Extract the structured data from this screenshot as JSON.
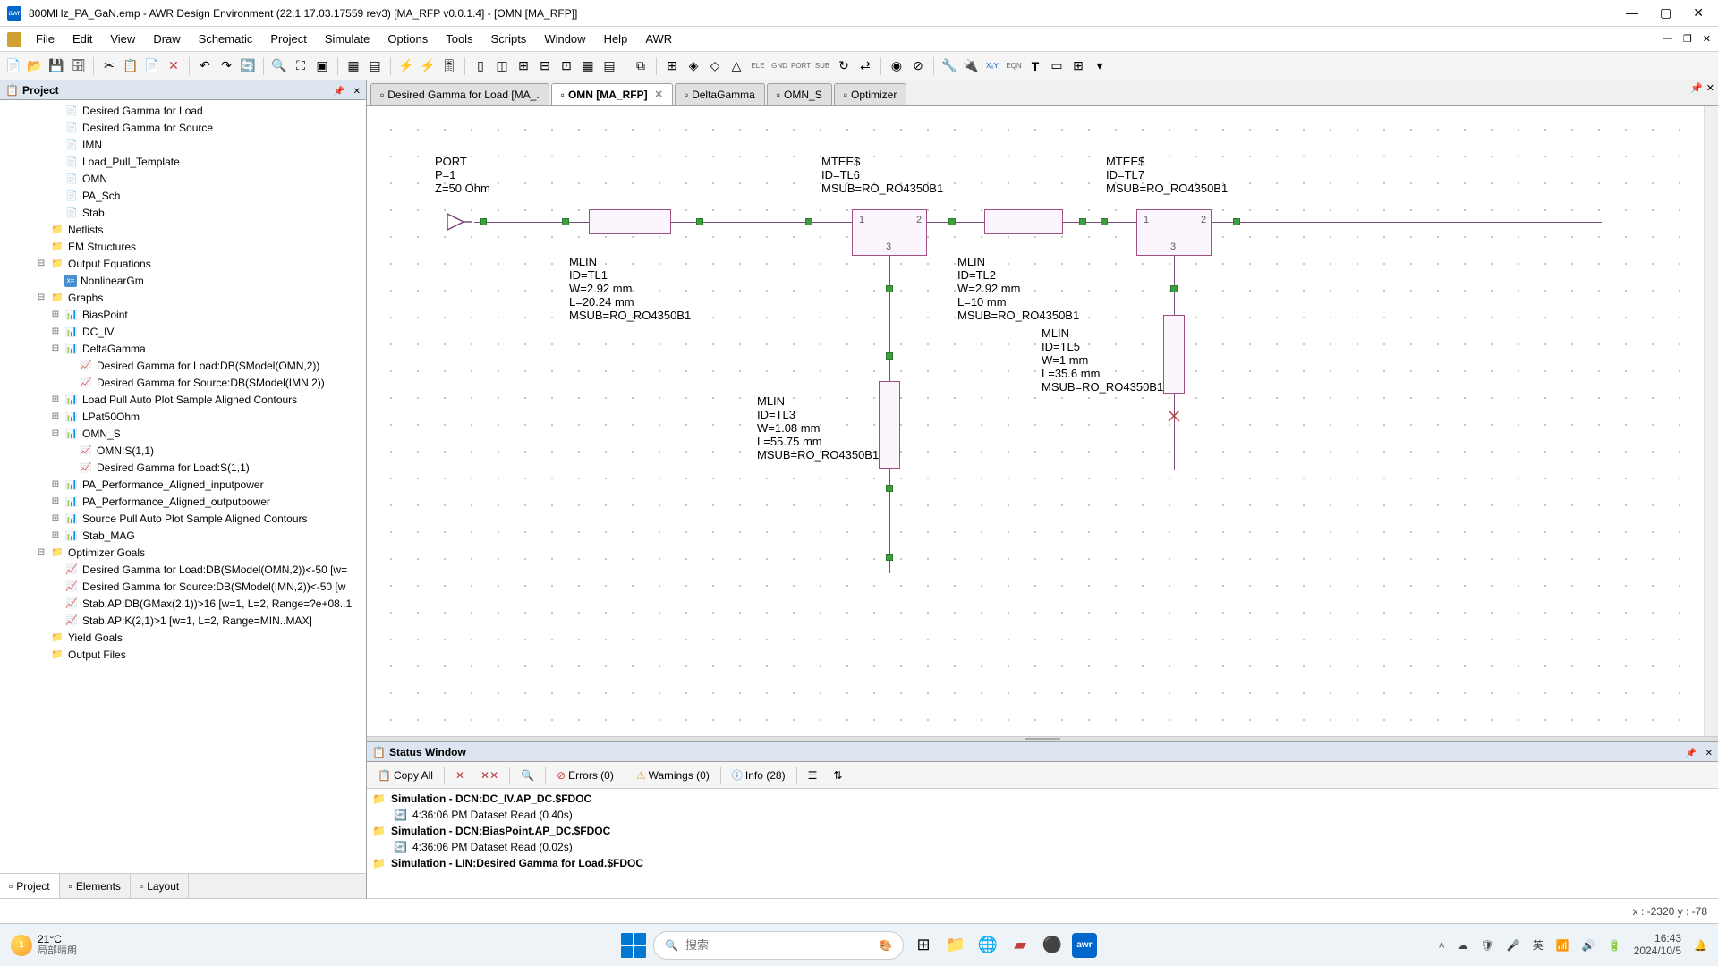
{
  "window": {
    "title": "800MHz_PA_GaN.emp - AWR Design Environment (22.1 17.03.17559 rev3) [MA_RFP v0.0.1.4] - [OMN [MA_RFP]]",
    "app_badge": "awr"
  },
  "menu": [
    "File",
    "Edit",
    "View",
    "Draw",
    "Schematic",
    "Project",
    "Simulate",
    "Options",
    "Tools",
    "Scripts",
    "Window",
    "Help",
    "AWR"
  ],
  "project_panel": {
    "title": "Project",
    "tree": [
      {
        "lvl": 3,
        "exp": "",
        "ic": "sch",
        "label": "Desired Gamma for Load"
      },
      {
        "lvl": 3,
        "exp": "",
        "ic": "sch",
        "label": "Desired Gamma for Source"
      },
      {
        "lvl": 3,
        "exp": "",
        "ic": "sch",
        "label": "IMN"
      },
      {
        "lvl": 3,
        "exp": "",
        "ic": "sch",
        "label": "Load_Pull_Template"
      },
      {
        "lvl": 3,
        "exp": "",
        "ic": "sch",
        "label": "OMN"
      },
      {
        "lvl": 3,
        "exp": "",
        "ic": "sch",
        "label": "PA_Sch"
      },
      {
        "lvl": 3,
        "exp": "",
        "ic": "sch",
        "label": "Stab"
      },
      {
        "lvl": 2,
        "exp": "",
        "ic": "folder",
        "label": "Netlists"
      },
      {
        "lvl": 2,
        "exp": "",
        "ic": "folder",
        "label": "EM Structures"
      },
      {
        "lvl": 2,
        "exp": "-",
        "ic": "folder",
        "label": "Output Equations"
      },
      {
        "lvl": 3,
        "exp": "",
        "ic": "eq",
        "label": "NonlinearGm"
      },
      {
        "lvl": 2,
        "exp": "-",
        "ic": "folder",
        "label": "Graphs"
      },
      {
        "lvl": 3,
        "exp": "+",
        "ic": "graph",
        "label": "BiasPoint"
      },
      {
        "lvl": 3,
        "exp": "+",
        "ic": "graph",
        "label": "DC_IV"
      },
      {
        "lvl": 3,
        "exp": "-",
        "ic": "graph",
        "label": "DeltaGamma"
      },
      {
        "lvl": 4,
        "exp": "",
        "ic": "meas",
        "label": "Desired Gamma for Load:DB(SModel(OMN,2))"
      },
      {
        "lvl": 4,
        "exp": "",
        "ic": "meas",
        "label": "Desired Gamma for Source:DB(SModel(IMN,2))"
      },
      {
        "lvl": 3,
        "exp": "+",
        "ic": "graph",
        "label": "Load Pull Auto Plot Sample Aligned Contours"
      },
      {
        "lvl": 3,
        "exp": "+",
        "ic": "graph",
        "label": "LPat50Ohm"
      },
      {
        "lvl": 3,
        "exp": "-",
        "ic": "graph",
        "label": "OMN_S"
      },
      {
        "lvl": 4,
        "exp": "",
        "ic": "meas",
        "label": "OMN:S(1,1)"
      },
      {
        "lvl": 4,
        "exp": "",
        "ic": "meas",
        "label": "Desired Gamma for Load:S(1,1)"
      },
      {
        "lvl": 3,
        "exp": "+",
        "ic": "graph",
        "label": "PA_Performance_Aligned_inputpower"
      },
      {
        "lvl": 3,
        "exp": "+",
        "ic": "graph",
        "label": "PA_Performance_Aligned_outputpower"
      },
      {
        "lvl": 3,
        "exp": "+",
        "ic": "graph",
        "label": "Source Pull Auto Plot Sample Aligned Contours"
      },
      {
        "lvl": 3,
        "exp": "+",
        "ic": "graph",
        "label": "Stab_MAG"
      },
      {
        "lvl": 2,
        "exp": "-",
        "ic": "folder",
        "label": "Optimizer Goals"
      },
      {
        "lvl": 3,
        "exp": "",
        "ic": "meas",
        "label": "Desired Gamma for Load:DB(SModel(OMN,2))<-50 [w="
      },
      {
        "lvl": 3,
        "exp": "",
        "ic": "meas",
        "label": "Desired Gamma for Source:DB(SModel(IMN,2))<-50 [w"
      },
      {
        "lvl": 3,
        "exp": "",
        "ic": "meas",
        "label": "Stab.AP:DB(GMax(2,1))>16 [w=1, L=2, Range=?e+08..1"
      },
      {
        "lvl": 3,
        "exp": "",
        "ic": "meas",
        "label": "Stab.AP:K(2,1)>1 [w=1, L=2, Range=MIN..MAX]"
      },
      {
        "lvl": 2,
        "exp": "",
        "ic": "folder",
        "label": "Yield Goals"
      },
      {
        "lvl": 2,
        "exp": "",
        "ic": "folder",
        "label": "Output Files"
      }
    ],
    "tabs": [
      {
        "label": "Project",
        "active": true
      },
      {
        "label": "Elements",
        "active": false
      },
      {
        "label": "Layout",
        "active": false
      }
    ]
  },
  "doc_tabs": [
    {
      "label": "Desired Gamma for Load [MA_.",
      "active": false,
      "close": false
    },
    {
      "label": "OMN [MA_RFP]",
      "active": true,
      "close": true
    },
    {
      "label": "DeltaGamma",
      "active": false,
      "close": false
    },
    {
      "label": "OMN_S",
      "active": false,
      "close": false
    },
    {
      "label": "Optimizer",
      "active": false,
      "close": false
    }
  ],
  "schematic": {
    "port": {
      "lines": [
        "PORT",
        "P=1",
        "Z=50 Ohm"
      ]
    },
    "mtee1": {
      "lines": [
        "MTEE$",
        "ID=TL6",
        "MSUB=RO_RO4350B1"
      ]
    },
    "mtee2": {
      "lines": [
        "MTEE$",
        "ID=TL7",
        "MSUB=RO_RO4350B1"
      ]
    },
    "mlin1": {
      "lines": [
        "MLIN",
        "ID=TL1",
        "W=2.92 mm",
        "L=20.24 mm",
        "MSUB=RO_RO4350B1"
      ]
    },
    "mlin2": {
      "lines": [
        "MLIN",
        "ID=TL2",
        "W=2.92 mm",
        "L=10 mm",
        "MSUB=RO_RO4350B1"
      ]
    },
    "mlin3": {
      "lines": [
        "MLIN",
        "ID=TL3",
        "W=1.08 mm",
        "L=55.75 mm",
        "MSUB=RO_RO4350B1"
      ]
    },
    "mlin5": {
      "lines": [
        "MLIN",
        "ID=TL5",
        "W=1 mm",
        "L=35.6 mm",
        "MSUB=RO_RO4350B1"
      ]
    }
  },
  "status_panel": {
    "title": "Status Window",
    "copy_all": "Copy All",
    "errors": "Errors (0)",
    "warnings": "Warnings (0)",
    "info": "Info (28)",
    "log": [
      {
        "type": "hdr",
        "label": "Simulation   - DCN:DC_IV.AP_DC.$FDOC"
      },
      {
        "type": "sub",
        "label": "4:36:06 PM    Dataset Read (0.40s)"
      },
      {
        "type": "hdr",
        "label": "Simulation   - DCN:BiasPoint.AP_DC.$FDOC"
      },
      {
        "type": "sub",
        "label": "4:36:06 PM    Dataset Read (0.02s)"
      },
      {
        "type": "hdr",
        "label": "Simulation   - LIN:Desired Gamma for Load.$FDOC"
      }
    ]
  },
  "statusbar": {
    "coords": "x : -2320    y : -78"
  },
  "taskbar": {
    "temp": "21°C",
    "temp_badge": "1",
    "weather_desc": "局部晴朗",
    "search_placeholder": "搜索",
    "ime": "英",
    "time": "16:43",
    "date": "2024/10/5"
  }
}
